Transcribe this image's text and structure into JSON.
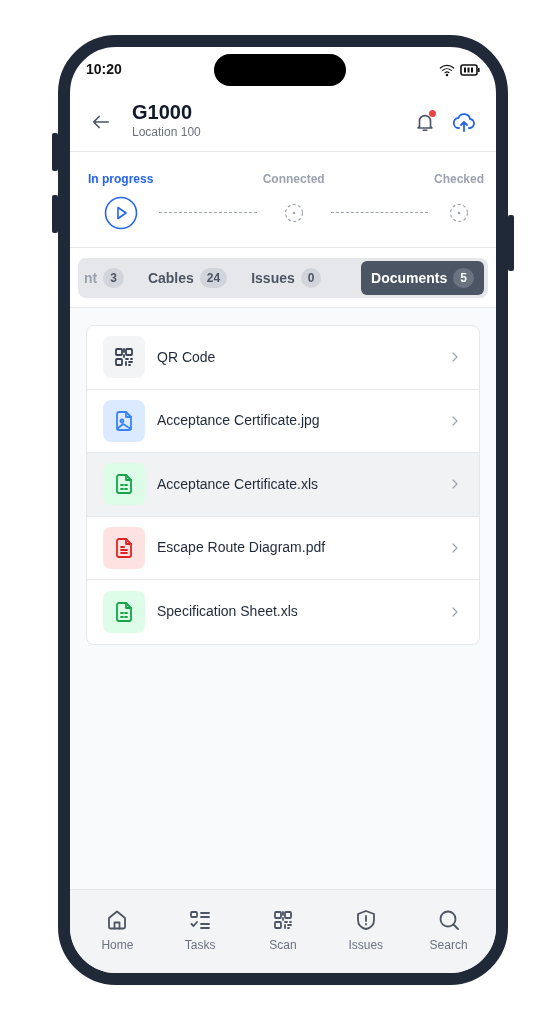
{
  "status_bar": {
    "time": "10:20"
  },
  "header": {
    "title": "G1000",
    "subtitle": "Location 100",
    "notification_unread": true
  },
  "steps": [
    {
      "label": "In progress",
      "active": true
    },
    {
      "label": "Connected",
      "active": false
    },
    {
      "label": "Checked",
      "active": false
    }
  ],
  "tabs": [
    {
      "label": "nt",
      "count": "3",
      "selected": false
    },
    {
      "label": "Cables",
      "count": "24",
      "selected": false
    },
    {
      "label": "Issues",
      "count": "0",
      "selected": false
    },
    {
      "label": "Documents",
      "count": "5",
      "selected": true
    }
  ],
  "documents": [
    {
      "name": "QR Code",
      "kind": "qr",
      "selected": false
    },
    {
      "name": "Acceptance Certificate.jpg",
      "kind": "image",
      "selected": false
    },
    {
      "name": "Acceptance Certificate.xls",
      "kind": "sheet",
      "selected": true
    },
    {
      "name": "Escape Route Diagram.pdf",
      "kind": "pdf",
      "selected": false
    },
    {
      "name": "Specification Sheet.xls",
      "kind": "sheet",
      "selected": false
    }
  ],
  "nav": [
    {
      "label": "Home",
      "kind": "home"
    },
    {
      "label": "Tasks",
      "kind": "tasks"
    },
    {
      "label": "Scan",
      "kind": "scan"
    },
    {
      "label": "Issues",
      "kind": "issues"
    },
    {
      "label": "Search",
      "kind": "search"
    }
  ]
}
